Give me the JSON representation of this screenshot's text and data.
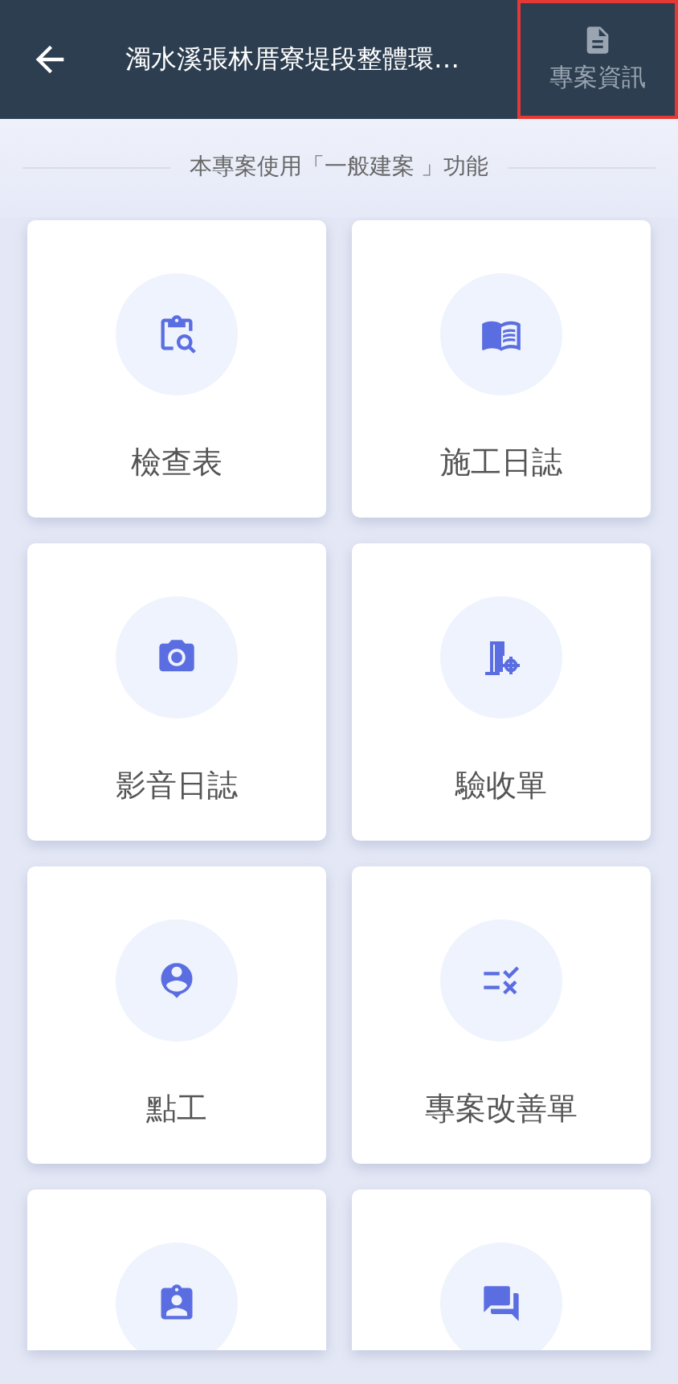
{
  "header": {
    "title": "濁水溪張林厝寮堤段整體環…",
    "info_button": {
      "label": "專案資訊",
      "highlighted": true
    }
  },
  "notice": "本專案使用「一般建案 」功能",
  "tiles": [
    {
      "label": "檢查表",
      "cut_off": false
    },
    {
      "label": "施工日誌",
      "cut_off": false
    },
    {
      "label": "影音日誌",
      "cut_off": false
    },
    {
      "label": "驗收單",
      "cut_off": false
    },
    {
      "label": "點工",
      "cut_off": false
    },
    {
      "label": "專案改善單",
      "cut_off": false
    },
    {
      "cut_off": true
    },
    {
      "cut_off": true
    }
  ]
}
